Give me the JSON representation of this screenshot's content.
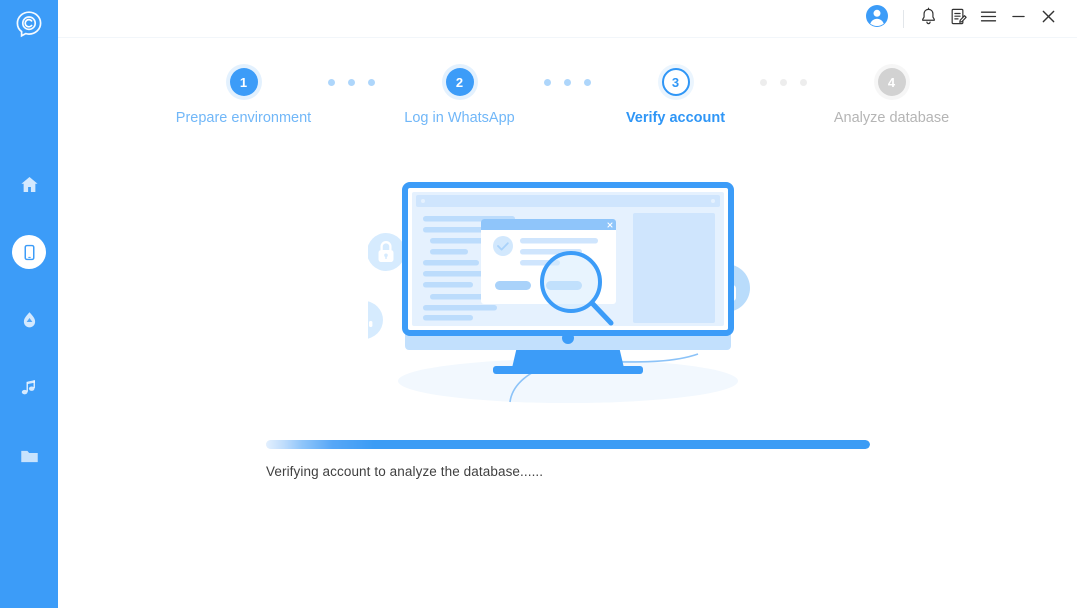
{
  "app": {
    "logo_icon": "chat-bubble-c-logo",
    "brand_color": "#3c9cf8"
  },
  "sidebar": {
    "items": [
      {
        "name": "home",
        "icon": "home-icon",
        "active": false
      },
      {
        "name": "phone",
        "icon": "phone-icon",
        "active": true
      },
      {
        "name": "cloud",
        "icon": "cloud-drop-icon",
        "active": false
      },
      {
        "name": "music",
        "icon": "music-note-icon",
        "active": false
      },
      {
        "name": "files",
        "icon": "folder-icon",
        "active": false
      }
    ]
  },
  "titlebar": {
    "buttons": [
      {
        "name": "account-avatar",
        "icon": "user-avatar-icon"
      },
      {
        "name": "notifications",
        "icon": "bell-icon"
      },
      {
        "name": "feedback",
        "icon": "note-edit-icon"
      },
      {
        "name": "menu",
        "icon": "hamburger-menu-icon"
      },
      {
        "name": "minimize",
        "icon": "minimize-icon"
      },
      {
        "name": "close",
        "icon": "close-icon"
      }
    ]
  },
  "stepper": {
    "steps": [
      {
        "number": "1",
        "label": "Prepare environment",
        "state": "done"
      },
      {
        "number": "2",
        "label": "Log in WhatsApp",
        "state": "done"
      },
      {
        "number": "3",
        "label": "Verify account",
        "state": "current"
      },
      {
        "number": "4",
        "label": "Analyze database",
        "state": "pending"
      }
    ],
    "connectors": [
      {
        "state": "on"
      },
      {
        "state": "on"
      },
      {
        "state": "off"
      }
    ]
  },
  "illustration": {
    "name": "database-scan-illustration",
    "badges": [
      "lock-icon",
      "bar-chart-icon",
      "lock-icon"
    ],
    "elements": [
      "monitor",
      "dialog-window",
      "magnifier-icon",
      "monitor-stand",
      "cable"
    ]
  },
  "progress": {
    "percent": 100,
    "status_text": "Verifying account to analyze the database......",
    "fill_color": "#3b9cf5",
    "track_color": "#edf1f5"
  }
}
